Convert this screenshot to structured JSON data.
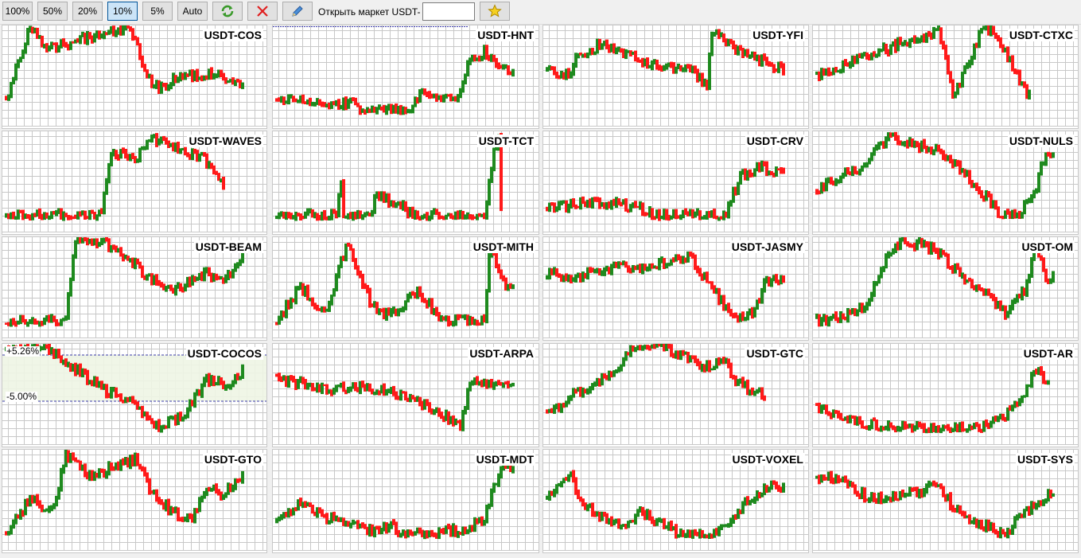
{
  "toolbar": {
    "zoom_buttons": [
      "100%",
      "50%",
      "20%",
      "10%",
      "5%",
      "Auto"
    ],
    "active_zoom": "10%",
    "refresh_icon": "refresh-icon",
    "close_icon": "close-icon",
    "edit_icon": "pencil-icon",
    "favorite_icon": "star-icon",
    "open_market_label": "Открыть маркет USDT-",
    "market_input_value": ""
  },
  "colors": {
    "up": "#1f8a1f",
    "down": "#ff1a1a",
    "grid": "#c8c8c8",
    "level_line": "#3a3aa8",
    "band_fill": "#eef5e4",
    "star": "#f5d020"
  },
  "markets": [
    {
      "title": "USDT-COS",
      "shape": [
        [
          0.0,
          0.05,
          0.85
        ],
        [
          0.1,
          0.5,
          0.01
        ],
        [
          0.17,
          0.05,
          0.25
        ],
        [
          0.52,
          0.52,
          0.02
        ],
        [
          0.62,
          0.72,
          0.7
        ],
        [
          0.78,
          0.57,
          0.55
        ],
        [
          0.9,
          0.8,
          0.55
        ],
        [
          1.0,
          0.45,
          0.65
        ]
      ]
    },
    {
      "title": "USDT-HNT",
      "shape": [
        [
          0.0,
          0.3,
          0.85
        ],
        [
          0.1,
          0.25,
          0.85
        ],
        [
          0.25,
          0.3,
          0.9
        ],
        [
          0.33,
          0.36,
          0.84
        ],
        [
          0.34,
          0.34,
          0.96
        ],
        [
          0.56,
          0.36,
          0.96
        ],
        [
          0.62,
          0.3,
          0.75
        ],
        [
          0.7,
          0.4,
          0.8
        ],
        [
          0.75,
          0.35,
          0.85
        ],
        [
          0.82,
          0.6,
          0.4
        ],
        [
          0.88,
          0.68,
          0.3
        ],
        [
          1.0,
          0.62,
          0.55
        ]
      ]
    },
    {
      "title": "USDT-YFI",
      "shape": [
        [
          0.0,
          0.05,
          0.5
        ],
        [
          0.1,
          0.2,
          0.55
        ],
        [
          0.12,
          0.42,
          0.4
        ],
        [
          0.22,
          0.48,
          0.22
        ],
        [
          0.3,
          0.65,
          0.3
        ],
        [
          0.4,
          0.75,
          0.4
        ],
        [
          0.5,
          0.65,
          0.45
        ],
        [
          0.6,
          0.58,
          0.5
        ],
        [
          0.68,
          0.8,
          0.65
        ],
        [
          0.69,
          0.78,
          0.15
        ],
        [
          0.72,
          0.85,
          0.1
        ],
        [
          0.8,
          0.7,
          0.3
        ],
        [
          0.9,
          0.6,
          0.38
        ],
        [
          1.0,
          0.55,
          0.5
        ]
      ]
    },
    {
      "title": "USDT-CTXC",
      "shape": [
        [
          0.0,
          0.12,
          0.55
        ],
        [
          0.52,
          0.52,
          0.05
        ],
        [
          0.58,
          0.7,
          0.8
        ],
        [
          0.64,
          0.8,
          0.4
        ],
        [
          0.7,
          0.25,
          0.05
        ],
        [
          0.75,
          0.3,
          0.05
        ],
        [
          0.8,
          0.7,
          0.3
        ],
        [
          0.9,
          0.7,
          0.8
        ]
      ]
    },
    {
      "title": "USDT-WAVES",
      "shape": [
        [
          0.0,
          0.05,
          0.95
        ],
        [
          0.4,
          0.45,
          0.95
        ],
        [
          0.45,
          0.7,
          0.2
        ],
        [
          0.55,
          0.65,
          0.35
        ],
        [
          0.6,
          0.6,
          0.05
        ],
        [
          0.68,
          0.75,
          0.15
        ],
        [
          0.74,
          0.82,
          0.2
        ],
        [
          0.84,
          0.84,
          0.3
        ],
        [
          0.9,
          0.8,
          0.5
        ],
        [
          0.92,
          0.8,
          0.6
        ]
      ]
    },
    {
      "title": "USDT-TCT",
      "shape": [
        [
          0.0,
          0.05,
          0.95
        ],
        [
          0.25,
          0.3,
          0.95
        ],
        [
          0.27,
          0.55,
          0.5
        ],
        [
          0.28,
          0.55,
          0.95
        ],
        [
          0.4,
          0.45,
          0.95
        ],
        [
          0.42,
          0.58,
          0.7
        ],
        [
          0.6,
          0.68,
          0.95
        ],
        [
          0.88,
          0.9,
          0.95
        ],
        [
          0.92,
          0.7,
          0.2
        ],
        [
          0.94,
          0.85,
          0.1
        ],
        [
          0.95,
          0.88,
          0.9
        ]
      ]
    },
    {
      "title": "USDT-CRV",
      "shape": [
        [
          0.0,
          0.05,
          0.85
        ],
        [
          0.2,
          0.25,
          0.8
        ],
        [
          0.4,
          0.45,
          0.85
        ],
        [
          0.45,
          0.48,
          0.95
        ],
        [
          0.75,
          0.78,
          0.95
        ],
        [
          0.82,
          0.88,
          0.5
        ],
        [
          0.9,
          0.92,
          0.4
        ],
        [
          1.0,
          0.55,
          0.5
        ]
      ]
    },
    {
      "title": "USDT-NULS",
      "shape": [
        [
          0.0,
          0.2,
          0.65
        ],
        [
          0.1,
          0.25,
          0.5
        ],
        [
          0.2,
          0.4,
          0.4
        ],
        [
          0.25,
          0.55,
          0.15
        ],
        [
          0.32,
          0.75,
          0.05
        ],
        [
          0.4,
          0.85,
          0.15
        ],
        [
          0.5,
          0.9,
          0.18
        ],
        [
          0.6,
          0.7,
          0.4
        ],
        [
          0.72,
          0.62,
          0.75
        ],
        [
          0.78,
          0.8,
          0.95
        ],
        [
          0.85,
          0.9,
          0.95
        ],
        [
          0.92,
          0.95,
          0.7
        ],
        [
          0.96,
          0.99,
          0.3
        ],
        [
          1.0,
          0.6,
          0.3
        ]
      ]
    },
    {
      "title": "USDT-BEAM",
      "shape": [
        [
          0.0,
          0.05,
          0.95
        ],
        [
          0.25,
          0.27,
          0.95
        ],
        [
          0.29,
          0.31,
          0.05
        ],
        [
          0.4,
          0.4,
          0.05
        ],
        [
          0.5,
          0.55,
          0.2
        ],
        [
          0.6,
          0.62,
          0.45
        ],
        [
          0.7,
          0.7,
          0.6
        ],
        [
          0.75,
          0.78,
          0.55
        ],
        [
          0.85,
          0.87,
          0.4
        ],
        [
          0.92,
          0.92,
          0.5
        ],
        [
          1.0,
          0.5,
          0.2
        ]
      ]
    },
    {
      "title": "USDT-MITH",
      "shape": [
        [
          0.0,
          0.1,
          0.95
        ],
        [
          0.1,
          0.15,
          0.55
        ],
        [
          0.2,
          0.22,
          0.9
        ],
        [
          0.3,
          0.2,
          0.05
        ],
        [
          0.4,
          0.45,
          0.75
        ],
        [
          0.48,
          0.5,
          0.9
        ],
        [
          0.6,
          0.63,
          0.6
        ],
        [
          0.7,
          0.72,
          0.95
        ],
        [
          0.88,
          0.88,
          0.95
        ],
        [
          0.9,
          0.92,
          0.1
        ],
        [
          0.95,
          0.95,
          0.5
        ],
        [
          1.0,
          0.6,
          0.6
        ]
      ]
    },
    {
      "title": "USDT-JASMY",
      "shape": [
        [
          0.0,
          0.05,
          0.4
        ],
        [
          0.1,
          0.2,
          0.45
        ],
        [
          0.2,
          0.35,
          0.4
        ],
        [
          0.3,
          0.5,
          0.3
        ],
        [
          0.4,
          0.6,
          0.35
        ],
        [
          0.5,
          0.7,
          0.3
        ],
        [
          0.6,
          0.75,
          0.2
        ],
        [
          0.7,
          0.8,
          0.6
        ],
        [
          0.8,
          0.82,
          0.9
        ],
        [
          0.88,
          0.88,
          0.85
        ],
        [
          0.92,
          0.95,
          0.5
        ],
        [
          1.0,
          0.5,
          0.45
        ]
      ]
    },
    {
      "title": "USDT-OM",
      "shape": [
        [
          0.0,
          0.05,
          0.95
        ],
        [
          0.1,
          0.2,
          0.9
        ],
        [
          0.2,
          0.3,
          0.8
        ],
        [
          0.28,
          0.35,
          0.3
        ],
        [
          0.35,
          0.45,
          0.05
        ],
        [
          0.45,
          0.55,
          0.08
        ],
        [
          0.52,
          0.58,
          0.2
        ],
        [
          0.6,
          0.62,
          0.4
        ],
        [
          0.7,
          0.72,
          0.6
        ],
        [
          0.8,
          0.82,
          0.85
        ],
        [
          0.88,
          0.9,
          0.6
        ],
        [
          0.92,
          0.92,
          0.1
        ],
        [
          0.98,
          0.98,
          0.5
        ],
        [
          1.0,
          0.5,
          0.45
        ]
      ]
    },
    {
      "title": "USDT-COCOS",
      "shape": [
        [
          0.0,
          0.05,
          0.1
        ],
        [
          0.15,
          0.2,
          0.0
        ],
        [
          0.25,
          0.3,
          0.2
        ],
        [
          0.4,
          0.45,
          0.5
        ],
        [
          0.55,
          0.6,
          0.7
        ],
        [
          0.65,
          0.7,
          0.95
        ],
        [
          0.75,
          0.78,
          0.8
        ],
        [
          0.85,
          0.88,
          0.4
        ],
        [
          0.95,
          0.95,
          0.45
        ],
        [
          1.0,
          0.3,
          0.3
        ]
      ],
      "levels": {
        "upper": "+5.26%",
        "lower": "-5.00%"
      }
    },
    {
      "title": "USDT-ARPA",
      "shape": [
        [
          0.0,
          0.05,
          0.4
        ],
        [
          0.1,
          0.15,
          0.45
        ],
        [
          0.2,
          0.3,
          0.5
        ],
        [
          0.3,
          0.4,
          0.48
        ],
        [
          0.5,
          0.55,
          0.55
        ],
        [
          0.6,
          0.65,
          0.65
        ],
        [
          0.7,
          0.75,
          0.8
        ],
        [
          0.78,
          0.8,
          0.9
        ],
        [
          0.82,
          0.85,
          0.4
        ],
        [
          0.88,
          0.9,
          0.45
        ],
        [
          1.0,
          0.5,
          0.45
        ]
      ]
    },
    {
      "title": "USDT-GTC",
      "shape": [
        [
          0.0,
          0.05,
          0.8
        ],
        [
          0.1,
          0.15,
          0.6
        ],
        [
          0.2,
          0.25,
          0.45
        ],
        [
          0.3,
          0.32,
          0.3
        ],
        [
          0.35,
          0.4,
          0.05
        ],
        [
          0.5,
          0.52,
          0.05
        ],
        [
          0.55,
          0.6,
          0.1
        ],
        [
          0.65,
          0.68,
          0.25
        ],
        [
          0.75,
          0.78,
          0.2
        ],
        [
          0.8,
          0.82,
          0.4
        ],
        [
          0.85,
          0.88,
          0.5
        ],
        [
          0.92,
          0.94,
          0.6
        ]
      ]
    },
    {
      "title": "USDT-AR",
      "shape": [
        [
          0.0,
          0.05,
          0.7
        ],
        [
          0.1,
          0.15,
          0.8
        ],
        [
          0.2,
          0.3,
          0.9
        ],
        [
          0.35,
          0.45,
          0.92
        ],
        [
          0.5,
          0.6,
          0.95
        ],
        [
          0.7,
          0.75,
          0.95
        ],
        [
          0.85,
          0.88,
          0.7
        ],
        [
          0.92,
          0.94,
          0.3
        ],
        [
          0.98,
          1.0,
          0.4
        ]
      ]
    },
    {
      "title": "USDT-GTO",
      "shape": [
        [
          0.0,
          0.05,
          0.95
        ],
        [
          0.1,
          0.15,
          0.55
        ],
        [
          0.2,
          0.22,
          0.7
        ],
        [
          0.25,
          0.28,
          0.05
        ],
        [
          0.35,
          0.4,
          0.3
        ],
        [
          0.45,
          0.5,
          0.2
        ],
        [
          0.55,
          0.58,
          0.1
        ],
        [
          0.6,
          0.65,
          0.4
        ],
        [
          0.7,
          0.72,
          0.7
        ],
        [
          0.78,
          0.8,
          0.8
        ],
        [
          0.85,
          0.88,
          0.4
        ],
        [
          0.92,
          0.95,
          0.5
        ],
        [
          1.0,
          0.5,
          0.3
        ]
      ]
    },
    {
      "title": "USDT-MDT",
      "shape": [
        [
          0.0,
          0.05,
          0.8
        ],
        [
          0.1,
          0.15,
          0.6
        ],
        [
          0.2,
          0.25,
          0.75
        ],
        [
          0.3,
          0.35,
          0.8
        ],
        [
          0.4,
          0.45,
          0.9
        ],
        [
          0.48,
          0.5,
          0.85
        ],
        [
          0.55,
          0.6,
          0.95
        ],
        [
          0.8,
          0.82,
          0.9
        ],
        [
          0.88,
          0.9,
          0.75
        ],
        [
          0.95,
          0.95,
          0.2
        ],
        [
          1.0,
          0.1,
          0.2
        ]
      ]
    },
    {
      "title": "USDT-VOXEL",
      "shape": [
        [
          0.0,
          0.05,
          0.55
        ],
        [
          0.1,
          0.12,
          0.3
        ],
        [
          0.15,
          0.18,
          0.6
        ],
        [
          0.2,
          0.25,
          0.7
        ],
        [
          0.3,
          0.35,
          0.85
        ],
        [
          0.4,
          0.45,
          0.7
        ],
        [
          0.5,
          0.52,
          0.85
        ],
        [
          0.55,
          0.58,
          0.95
        ],
        [
          0.7,
          0.72,
          0.95
        ],
        [
          0.78,
          0.8,
          0.8
        ],
        [
          0.85,
          0.88,
          0.55
        ],
        [
          0.95,
          0.98,
          0.4
        ],
        [
          1.0,
          0.4,
          0.45
        ]
      ]
    },
    {
      "title": "USDT-SYS",
      "shape": [
        [
          0.0,
          0.05,
          0.3
        ],
        [
          0.1,
          0.15,
          0.35
        ],
        [
          0.2,
          0.3,
          0.5
        ],
        [
          0.3,
          0.35,
          0.55
        ],
        [
          0.4,
          0.45,
          0.5
        ],
        [
          0.5,
          0.55,
          0.4
        ],
        [
          0.6,
          0.65,
          0.7
        ],
        [
          0.7,
          0.75,
          0.85
        ],
        [
          0.8,
          0.82,
          0.95
        ],
        [
          0.88,
          0.9,
          0.7
        ],
        [
          0.95,
          0.98,
          0.55
        ],
        [
          1.0,
          0.4,
          0.45
        ]
      ]
    }
  ]
}
